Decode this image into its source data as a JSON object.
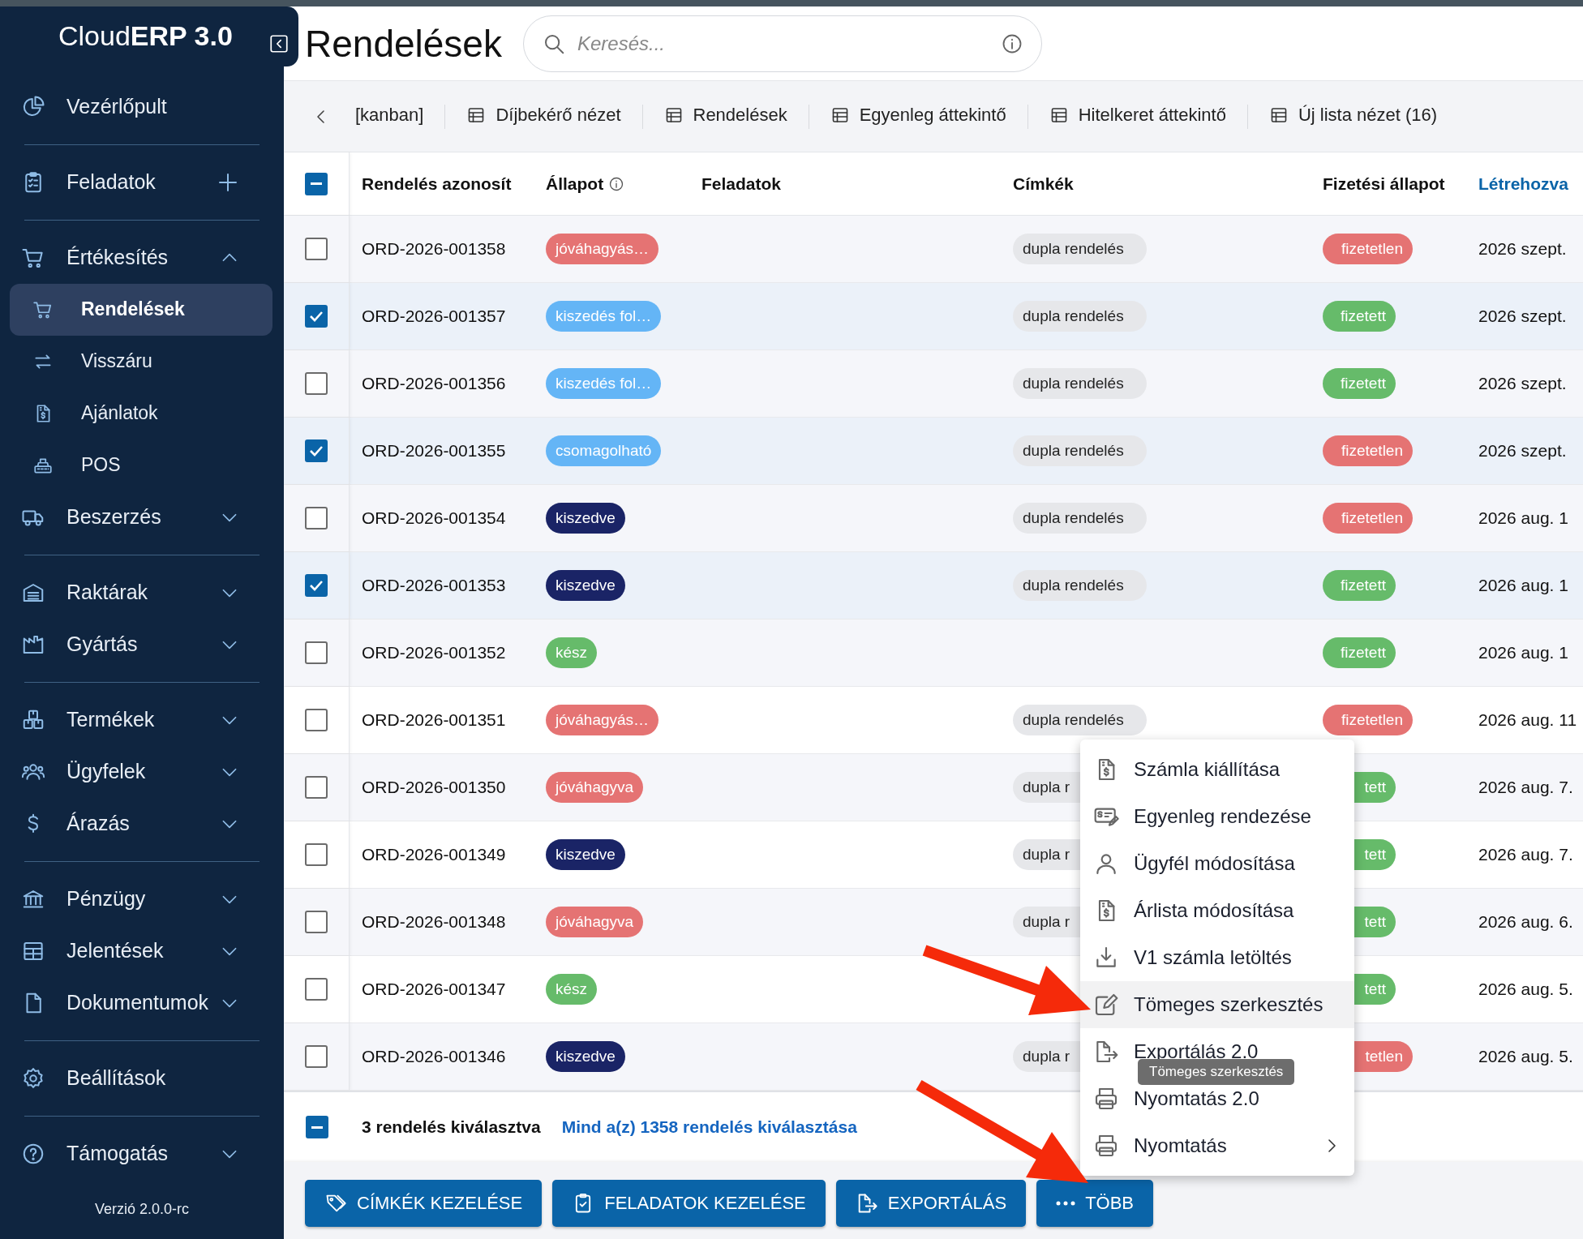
{
  "sidebar": {
    "logo": "Cloud**ERP 3.0**",
    "groups": [
      [
        {
          "label": "Vezérlőpult",
          "kind": "plain"
        }
      ],
      [
        {
          "label": "Feladatok",
          "kind": "add"
        }
      ],
      [
        {
          "label": "Értékesítés",
          "kind": "expandable",
          "expanded": true,
          "children": [
            {
              "label": "Rendelések",
              "selected": true
            },
            {
              "label": "Visszáru",
              "selected": false
            },
            {
              "label": "Ajánlatok",
              "selected": false
            },
            {
              "label": "POS",
              "selected": false
            }
          ]
        },
        {
          "label": "Beszerzés",
          "kind": "expandable",
          "expanded": false
        }
      ],
      [
        {
          "label": "Raktárak",
          "kind": "expandable",
          "expanded": false
        },
        {
          "label": "Gyártás",
          "kind": "expandable",
          "expanded": false
        }
      ],
      [
        {
          "label": "Termékek",
          "kind": "expandable",
          "expanded": false
        },
        {
          "label": "Ügyfelek",
          "kind": "expandable",
          "expanded": false
        },
        {
          "label": "Árazás",
          "kind": "expandable",
          "expanded": false
        }
      ],
      [
        {
          "label": "Pénzügy",
          "kind": "expandable",
          "expanded": false
        },
        {
          "label": "Jelentések",
          "kind": "expandable",
          "expanded": false
        },
        {
          "label": "Dokumentumok",
          "kind": "expandable",
          "expanded": false
        }
      ],
      [
        {
          "label": "Beállítások",
          "kind": "plain"
        }
      ],
      [
        {
          "label": "Támogatás",
          "kind": "expandable",
          "expanded": false
        }
      ]
    ],
    "version": "Verzió 2.0.0-rc"
  },
  "header": {
    "title": "Rendelések",
    "search": {
      "placeholder": "Keresés..."
    }
  },
  "view_tabs": [
    {
      "label": "[kanban]",
      "kind": "board",
      "selected": false
    },
    {
      "label": "Díjbekérő nézet",
      "kind": "table",
      "selected": false
    },
    {
      "label": "Rendelések",
      "kind": "table",
      "selected": false
    },
    {
      "label": "Egyenleg áttekintő",
      "kind": "table",
      "selected": false
    },
    {
      "label": "Hitelkeret áttekintő",
      "kind": "table",
      "selected": false
    },
    {
      "label": "Új lista nézet (16)",
      "kind": "table",
      "selected": false
    }
  ],
  "table": {
    "select_all": {
      "checked": true,
      "indeterminate": true
    },
    "columns": [
      {
        "label": "Rendelés azonosít",
        "info": false,
        "sorted": false
      },
      {
        "label": "Állapot",
        "info": true,
        "sorted": false
      },
      {
        "label": "Feladatok",
        "info": false,
        "sorted": false
      },
      {
        "label": "Címkék",
        "info": false,
        "sorted": false
      },
      {
        "label": "Fizetési állapot",
        "info": false,
        "sorted": false
      },
      {
        "label": "Létrehozva",
        "info": false,
        "sorted": true
      }
    ],
    "rows": [
      {
        "id": "ORD-2026-001358",
        "checked": false,
        "status": {
          "label": "jóváhagyás…",
          "color": "#e57373"
        },
        "tag": "dupla rendelés",
        "payment": {
          "label": "fizetetlen",
          "kind": "unpaid"
        },
        "created": "2026 szept."
      },
      {
        "id": "ORD-2026-001357",
        "checked": true,
        "status": {
          "label": "kiszedés fol…",
          "color": "#64b5f6"
        },
        "tag": "dupla rendelés",
        "payment": {
          "label": "fizetett",
          "kind": "paid"
        },
        "created": "2026 szept."
      },
      {
        "id": "ORD-2026-001356",
        "checked": false,
        "status": {
          "label": "kiszedés fol…",
          "color": "#64b5f6"
        },
        "tag": "dupla rendelés",
        "payment": {
          "label": "fizetett",
          "kind": "paid"
        },
        "created": "2026 szept."
      },
      {
        "id": "ORD-2026-001355",
        "checked": true,
        "status": {
          "label": "csomagolható",
          "color": "#64b5f6"
        },
        "tag": "dupla rendelés",
        "payment": {
          "label": "fizetetlen",
          "kind": "unpaid"
        },
        "created": "2026 szept."
      },
      {
        "id": "ORD-2026-001354",
        "checked": false,
        "status": {
          "label": "kiszedve",
          "color": "#1a2466"
        },
        "tag": "dupla rendelés",
        "payment": {
          "label": "fizetetlen",
          "kind": "unpaid"
        },
        "created": "2026 aug. 1"
      },
      {
        "id": "ORD-2026-001353",
        "checked": true,
        "status": {
          "label": "kiszedve",
          "color": "#1a2466"
        },
        "tag": "dupla rendelés",
        "payment": {
          "label": "fizetett",
          "kind": "paid"
        },
        "created": "2026 aug. 1"
      },
      {
        "id": "ORD-2026-001352",
        "checked": false,
        "status": {
          "label": "kész",
          "color": "#66bb6a"
        },
        "payment": {
          "label": "fizetett",
          "kind": "paid"
        },
        "created": "2026 aug. 1"
      },
      {
        "id": "ORD-2026-001351",
        "checked": false,
        "status": {
          "label": "jóváhagyás…",
          "color": "#e57373"
        },
        "tag": "dupla rendelés",
        "payment": {
          "label": "fizetetlen",
          "kind": "unpaid"
        },
        "created": "2026 aug. 11"
      },
      {
        "id": "ORD-2026-001350",
        "checked": false,
        "status": {
          "label": "jóváhagyva",
          "color": "#e57373"
        },
        "tag": "dupla r",
        "payment": {
          "label": "tett",
          "kind": "paid"
        },
        "created": "2026 aug. 7."
      },
      {
        "id": "ORD-2026-001349",
        "checked": false,
        "status": {
          "label": "kiszedve",
          "color": "#1a2466"
        },
        "tag": "dupla r",
        "payment": {
          "label": "tett",
          "kind": "paid"
        },
        "created": "2026 aug. 7."
      },
      {
        "id": "ORD-2026-001348",
        "checked": false,
        "status": {
          "label": "jóváhagyva",
          "color": "#e57373"
        },
        "tag": "dupla r",
        "payment": {
          "label": "tett",
          "kind": "paid"
        },
        "created": "2026 aug. 6."
      },
      {
        "id": "ORD-2026-001347",
        "checked": false,
        "status": {
          "label": "kész",
          "color": "#66bb6a"
        },
        "payment": {
          "label": "tett",
          "kind": "paid"
        },
        "created": "2026 aug. 5."
      },
      {
        "id": "ORD-2026-001346",
        "checked": false,
        "status": {
          "label": "kiszedve",
          "color": "#1a2466"
        },
        "tag": "dupla r",
        "payment": {
          "label": "tetlen",
          "kind": "unpaid"
        },
        "created": "2026 aug. 5."
      }
    ]
  },
  "selection": {
    "state": {
      "checked": true,
      "indeterminate": true
    },
    "count": "3 rendelés kiválasztva",
    "select_all_link": "Mind a(z) 1358 rendelés kiválasztása"
  },
  "actions": [
    {
      "label": "CÍMKÉK KEZELÉSE"
    },
    {
      "label": "FELADATOK KEZELÉSE"
    },
    {
      "label": "EXPORTÁLÁS"
    },
    {
      "label": "TÖBB"
    }
  ],
  "menu": {
    "items": [
      {
        "label": "Számla kiállítása",
        "selected": false,
        "submenu": false
      },
      {
        "label": "Egyenleg rendezése",
        "selected": false,
        "submenu": false
      },
      {
        "label": "Ügyfél módosítása",
        "selected": false,
        "submenu": false
      },
      {
        "label": "Árlista módosítása",
        "selected": false,
        "submenu": false
      },
      {
        "label": "V1 számla letöltés",
        "selected": false,
        "submenu": false
      },
      {
        "label": "Tömeges szerkesztés",
        "selected": true,
        "submenu": false
      },
      {
        "label": "Exportálás 2.0",
        "selected": false,
        "submenu": false
      },
      {
        "label": "Nyomtatás 2.0",
        "selected": false,
        "submenu": false
      },
      {
        "label": "Nyomtatás",
        "selected": false,
        "submenu": true
      }
    ],
    "tooltip": "Tömeges szerkesztés"
  }
}
